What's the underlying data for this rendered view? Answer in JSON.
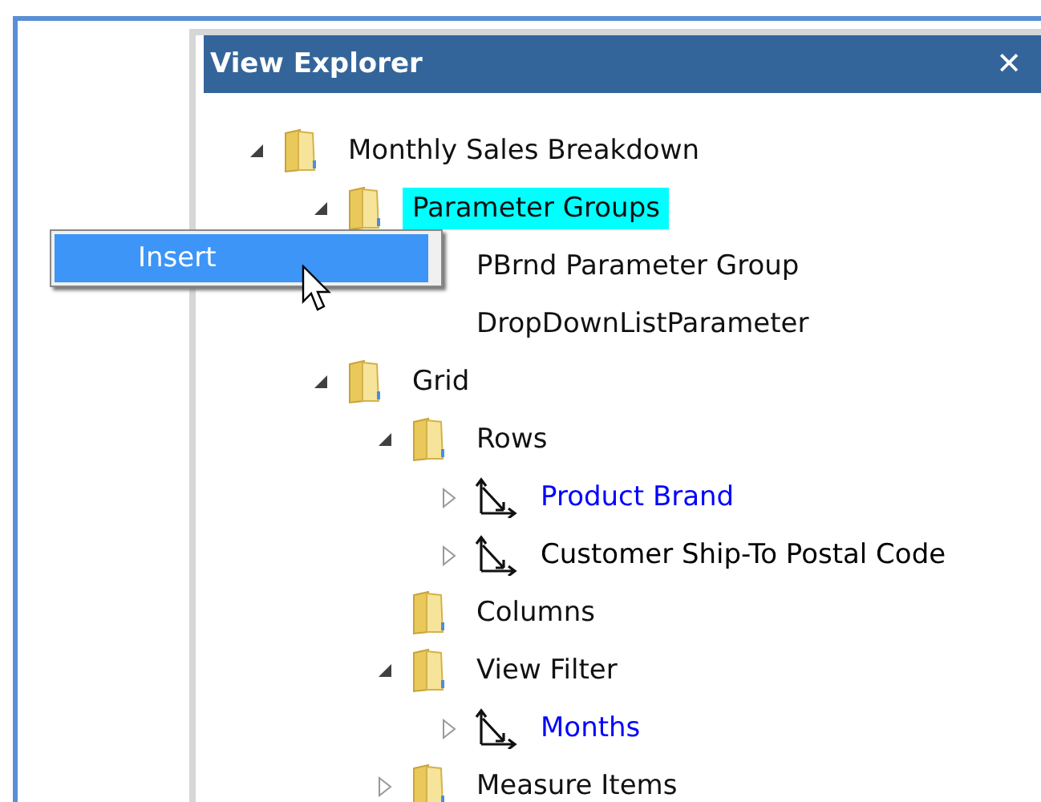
{
  "panel": {
    "title": "View Explorer",
    "close": "✕"
  },
  "tree": [
    {
      "label": "Monthly Sales Breakdown",
      "kind": "folder",
      "expanded": true,
      "selected": false,
      "children": [
        {
          "label": "Parameter Groups",
          "kind": "folder",
          "expanded": true,
          "selected": true,
          "children": [
            {
              "label": "PBrnd Parameter Group",
              "kind": "plain",
              "selected": false
            },
            {
              "label": "DropDownListParameter",
              "kind": "plain",
              "selected": false
            }
          ]
        },
        {
          "label": "Grid",
          "kind": "folder",
          "expanded": true,
          "selected": false,
          "children": [
            {
              "label": "Rows",
              "kind": "folder",
              "expanded": true,
              "selected": false,
              "children": [
                {
                  "label": "Product Brand",
                  "kind": "measure",
                  "expanded": false,
                  "selected": false,
                  "color": "#0000ff"
                },
                {
                  "label": "Customer Ship-To Postal Code",
                  "kind": "measure",
                  "expanded": false,
                  "selected": false,
                  "color": "#000000"
                }
              ]
            },
            {
              "label": "Columns",
              "kind": "folder",
              "selected": false
            },
            {
              "label": "View Filter",
              "kind": "folder",
              "expanded": true,
              "selected": false,
              "children": [
                {
                  "label": "Months",
                  "kind": "measure",
                  "expanded": false,
                  "selected": false,
                  "color": "#0000ff"
                }
              ]
            },
            {
              "label": "Measure Items",
              "kind": "folder",
              "expanded": false,
              "selected": false
            }
          ]
        }
      ]
    }
  ],
  "context_menu": {
    "items": [
      {
        "label": "Insert",
        "selected": true
      }
    ]
  }
}
